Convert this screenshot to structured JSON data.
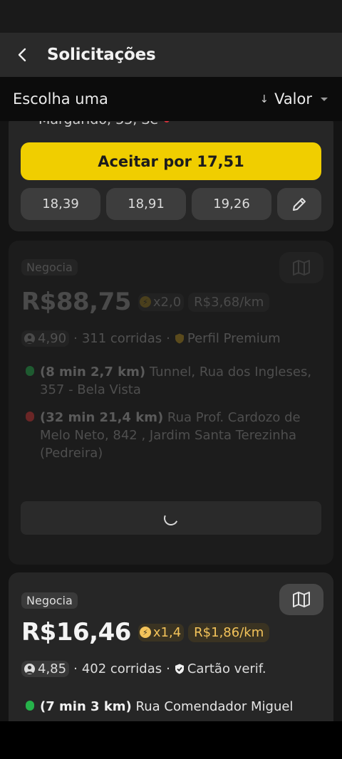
{
  "header": {
    "title": "Solicitações"
  },
  "filter": {
    "label": "Escolha uma",
    "sort_arrow": "↓",
    "sort_value": "Valor"
  },
  "cards": [
    {
      "address_cut": "Margarido, 33, Se",
      "accept_label": "Aceitar por 17,51",
      "offers": [
        "18,39",
        "18,91",
        "19,26"
      ]
    },
    {
      "tag": "Negocia",
      "price": "R$88,75",
      "multiplier": "x2,0",
      "per_km": "R$3,68/km",
      "rating": "4,90",
      "rides": "311 corridas",
      "badge": "Perfil Premium",
      "pickup_eta": "(8 min 2,7 km)",
      "pickup_addr": "Tunnel, Rua dos Ingleses, 357 - Bela Vista",
      "drop_eta": "(32 min 21,4 km)",
      "drop_addr": "Rua Prof. Cardozo de Melo Neto, 842 , Jardim Santa Terezinha (Pedreira)"
    },
    {
      "tag": "Negocia",
      "price": "R$16,46",
      "multiplier": "x1,4",
      "per_km": "R$1,86/km",
      "rating": "4,85",
      "rides": "402 corridas",
      "badge": "Cartão verif.",
      "pickup_eta": "(7 min 3 km)",
      "pickup_addr": "Rua Comendador Miguel"
    }
  ],
  "colors": {
    "accent": "#f0ce00",
    "multiplier": "#f3c35a",
    "pickup": "#26b24a",
    "dropoff": "#d9323c"
  }
}
